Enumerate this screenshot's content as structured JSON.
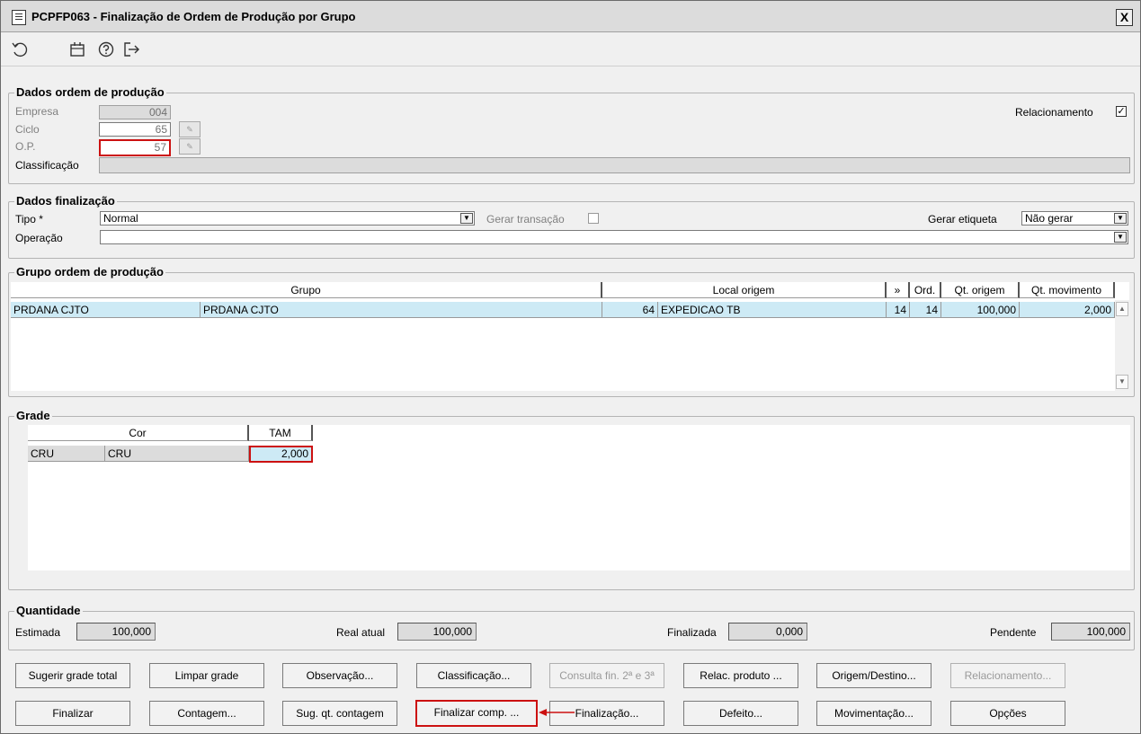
{
  "window": {
    "title": "PCPFP063 - Finalização de Ordem de Produção por Grupo",
    "close_label": "X"
  },
  "toolbar": {
    "icons": [
      "refresh-icon",
      "calendar-icon",
      "help-icon",
      "exit-icon"
    ]
  },
  "dados_ordem": {
    "title": "Dados ordem de produção",
    "empresa_label": "Empresa",
    "empresa_value": "004",
    "ciclo_label": "Ciclo",
    "ciclo_value": "65",
    "op_label": "O.P.",
    "op_value": "57",
    "classificacao_label": "Classificação",
    "classificacao_value": "",
    "relacionamento_label": "Relacionamento",
    "relacionamento_checked": "✓"
  },
  "dados_finalizacao": {
    "title": "Dados finalização",
    "tipo_label": "Tipo *",
    "tipo_value": "Normal",
    "gerar_transacao_label": "Gerar transação",
    "gerar_etiqueta_label": "Gerar etiqueta",
    "gerar_etiqueta_value": "Não gerar",
    "operacao_label": "Operação",
    "operacao_value": ""
  },
  "grupo_ordem": {
    "title": "Grupo ordem de produção",
    "headers": {
      "grupo": "Grupo",
      "local_origem": "Local origem",
      "nav": "»",
      "ord": "Ord.",
      "qt_origem": "Qt. origem",
      "qt_movimento": "Qt. movimento"
    },
    "rows": [
      {
        "grupo_code": "PRDANA CJTO",
        "grupo_desc": "PRDANA CJTO",
        "local_code": "64",
        "local_desc": "EXPEDICAO TB",
        "nav": "14",
        "ord": "14",
        "qt_origem": "100,000",
        "qt_movimento": "2,000"
      }
    ]
  },
  "grade": {
    "title": "Grade",
    "headers": {
      "cor": "Cor",
      "tam": "TAM"
    },
    "rows": [
      {
        "cor_code": "CRU",
        "cor_desc": "CRU",
        "tam_value": "2,000"
      }
    ]
  },
  "quantidade": {
    "title": "Quantidade",
    "estimada_label": "Estimada",
    "estimada_value": "100,000",
    "real_atual_label": "Real atual",
    "real_atual_value": "100,000",
    "finalizada_label": "Finalizada",
    "finalizada_value": "0,000",
    "pendente_label": "Pendente",
    "pendente_value": "100,000"
  },
  "buttons": {
    "row1": [
      "Sugerir grade total",
      "Limpar grade",
      "Observação...",
      "Classificação...",
      "Consulta fin. 2ª e 3ª",
      "Relac. produto ...",
      "Origem/Destino...",
      "Relacionamento..."
    ],
    "row2": [
      "Finalizar",
      "Contagem...",
      "Sug. qt. contagem",
      "Finalizar comp. ...",
      "Finalização...",
      "Defeito...",
      "Movimentação...",
      "Opções"
    ]
  },
  "colors": {
    "highlight": "#cc1111",
    "selected_row": "#cdeaf5",
    "panel": "#f0f0f0"
  }
}
